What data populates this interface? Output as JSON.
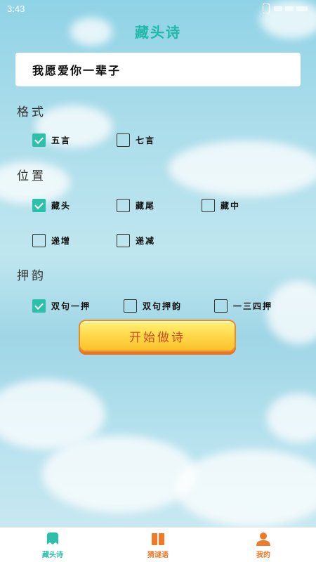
{
  "status": {
    "time": "3:43"
  },
  "app": {
    "title": "藏头诗"
  },
  "input": {
    "value": "我愿爱你一辈子"
  },
  "sections": {
    "format": {
      "label": "格式",
      "options": [
        {
          "label": "五言",
          "checked": true
        },
        {
          "label": "七言",
          "checked": false
        }
      ]
    },
    "position": {
      "label": "位置",
      "options": [
        {
          "label": "藏头",
          "checked": true
        },
        {
          "label": "藏尾",
          "checked": false
        },
        {
          "label": "藏中",
          "checked": false
        },
        {
          "label": "递增",
          "checked": false
        },
        {
          "label": "递减",
          "checked": false
        }
      ]
    },
    "rhyme": {
      "label": "押韵",
      "options": [
        {
          "label": "双句一押",
          "checked": true
        },
        {
          "label": "双句押韵",
          "checked": false
        },
        {
          "label": "一三四押",
          "checked": false
        }
      ]
    }
  },
  "start_button": {
    "label": "开始做诗"
  },
  "tabbar": {
    "tabs": [
      {
        "label": "藏头诗",
        "color": "#2cbfa9",
        "icon": "poem-icon"
      },
      {
        "label": "猜谜语",
        "color": "#f07a2a",
        "icon": "book-icon"
      },
      {
        "label": "我的",
        "color": "#f07a2a",
        "icon": "user-icon"
      }
    ]
  }
}
